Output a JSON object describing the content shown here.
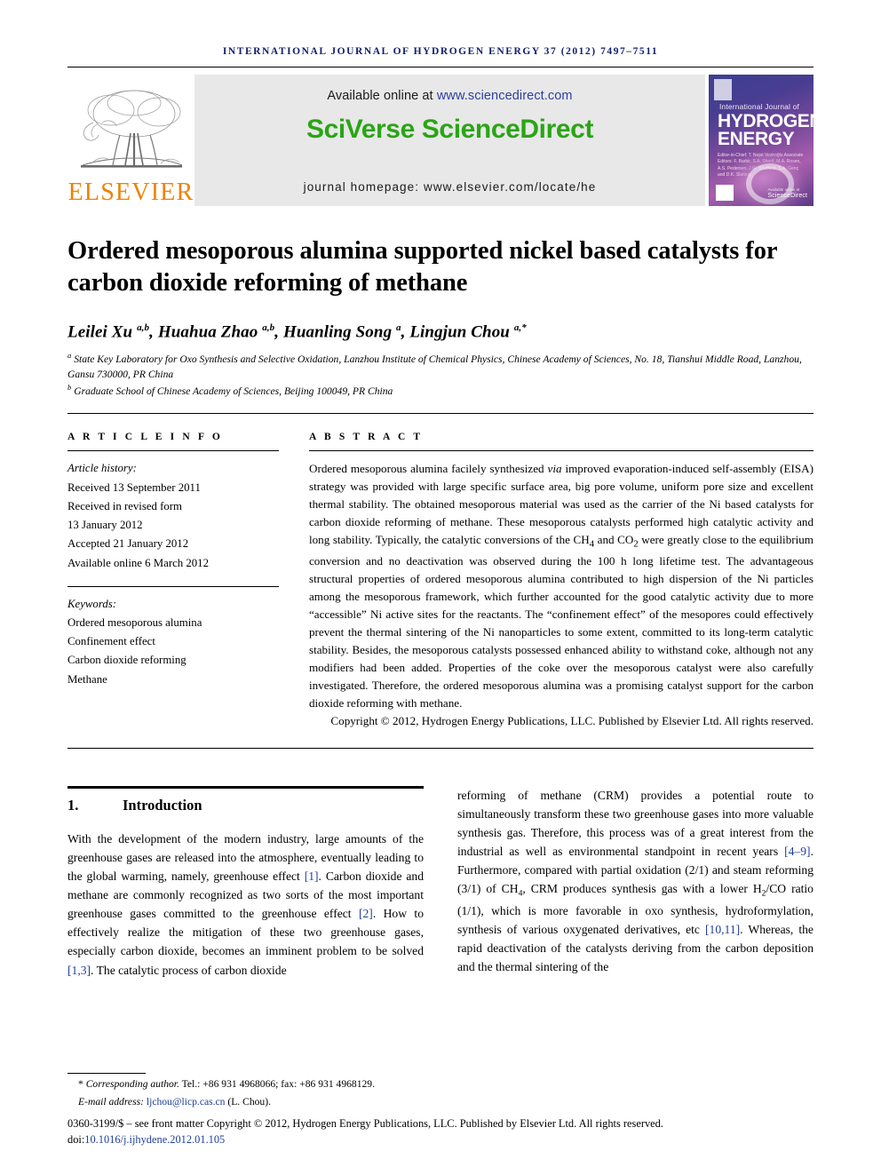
{
  "running_head": "International Journal of Hydrogen Energy 37 (2012) 7497–7511",
  "masthead": {
    "publisher_name": "ELSEVIER",
    "available_prefix": "Available online at ",
    "available_url": "www.sciencedirect.com",
    "platform_brand": "SciVerse ScienceDirect",
    "homepage_line": "journal homepage: www.elsevier.com/locate/he",
    "brand_green": "#2aa515",
    "brand_orange": "#ef8200",
    "link_blue": "#2b3fa0",
    "band_gray": "#e8e8e8",
    "cover": {
      "line_small": "International Journal of",
      "line_1": "HYDROGEN",
      "line_2": "ENERGY",
      "editors": "Editor-in-Chief: T. Nejat Veziroğlu\nAssociate Editors: F. Barbir, S.A. Sherif, M.A. Rosen, A.S. Pedersen, J.W. Sheffield, S.A. Genç and D.K. Slattery",
      "sciencedirect_label": "ScienceDirect",
      "sciencedirect_tiny": "Available online at"
    }
  },
  "title": "Ordered mesoporous alumina supported nickel based catalysts for carbon dioxide reforming of methane",
  "authors_html": "Leilei Xu <sup>a,b</sup>, Huahua Zhao <sup>a,b</sup>, Huanling Song <sup>a</sup>, Lingjun Chou <sup>a,*</sup>",
  "affiliations_html": "<sup>a</sup> State Key Laboratory for Oxo Synthesis and Selective Oxidation, Lanzhou Institute of Chemical Physics, Chinese Academy of Sciences, No. 18, Tianshui Middle Road, Lanzhou, Gansu 730000, PR China<br><sup>b</sup> Graduate School of Chinese Academy of Sciences, Beijing 100049, PR China",
  "article_info": {
    "heading": "A R T I C L E  I N F O",
    "history_label": "Article history:",
    "history": [
      "Received 13 September 2011",
      "Received in revised form",
      "13 January 2012",
      "Accepted 21 January 2012",
      "Available online 6 March 2012"
    ],
    "keywords_label": "Keywords:",
    "keywords": [
      "Ordered mesoporous alumina",
      "Confinement effect",
      "Carbon dioxide reforming",
      "Methane"
    ]
  },
  "abstract": {
    "heading": "A B S T R A C T",
    "body_html": "Ordered mesoporous alumina facilely synthesized <span class=\"it\">via</span> improved evaporation-induced self-assembly (EISA) strategy was provided with large specific surface area, big pore volume, uniform pore size and excellent thermal stability. The obtained mesoporous material was used as the carrier of the Ni based catalysts for carbon dioxide reforming of methane. These mesoporous catalysts performed high catalytic activity and long stability. Typically, the catalytic conversions of the CH<sub>4</sub> and CO<sub>2</sub> were greatly close to the equilibrium conversion and no deactivation was observed during the 100 h long lifetime test. The advantageous structural properties of ordered mesoporous alumina contributed to high dispersion of the Ni particles among the mesoporous framework, which further accounted for the good catalytic activity due to more “accessible” Ni active sites for the reactants. The “confinement effect” of the mesopores could effectively prevent the thermal sintering of the Ni nanoparticles to some extent, committed to its long-term catalytic stability. Besides, the mesoporous catalysts possessed enhanced ability to withstand coke, although not any modifiers had been added. Properties of the coke over the mesoporous catalyst were also carefully investigated. Therefore, the ordered mesoporous alumina was a promising catalyst support for the carbon dioxide reforming with methane.",
    "copyright": "Copyright © 2012, Hydrogen Energy Publications, LLC. Published by Elsevier Ltd. All rights reserved."
  },
  "section": {
    "number": "1.",
    "heading": "Introduction",
    "left_paragraph_html": "With the development of the modern industry, large amounts of the greenhouse gases are released into the atmosphere, eventually leading to the global warming, namely, greenhouse effect <span class=\"ref\">[1]</span>. Carbon dioxide and methane are commonly recognized as two sorts of the most important greenhouse gases committed to the greenhouse effect <span class=\"ref\">[2]</span>. How to effectively realize the mitigation of these two greenhouse gases, especially carbon dioxide, becomes an imminent problem to be solved <span class=\"ref\">[1,3]</span>. The catalytic process of carbon dioxide",
    "right_paragraph_html": "reforming of methane (CRM) provides a potential route to simultaneously transform these two greenhouse gases into more valuable synthesis gas. Therefore, this process was of a great interest from the industrial as well as environmental standpoint in recent years <span class=\"ref\">[4–9]</span>. Furthermore, compared with partial oxidation (2/1) and steam reforming (3/1) of CH<sub>4</sub>, CRM produces synthesis gas with a lower H<sub>2</sub>/CO ratio (1/1), which is more favorable in oxo synthesis, hydroformylation, synthesis of various oxygenated derivatives, <span class=\"it\">etc</span> <span class=\"ref\">[10,11]</span>. Whereas, the rapid deactivation of the catalysts deriving from the carbon deposition and the thermal sintering of the"
  },
  "footnote": {
    "corresponding_html": "<span class=\"it\">Corresponding author.</span> Tel.: +86 931 4968066; fax: +86 931 4968129.",
    "email_html": "<span class=\"it\">E-mail address:</span> <span class=\"fn-link\">ljchou@licp.cas.cn</span> (L. Chou).",
    "issn_line": "0360-3199/$ – see front matter Copyright © 2012, Hydrogen Energy Publications, LLC. Published by Elsevier Ltd. All rights reserved.",
    "doi_prefix": "doi:",
    "doi_value": "10.1016/j.ijhydene.2012.01.105"
  }
}
